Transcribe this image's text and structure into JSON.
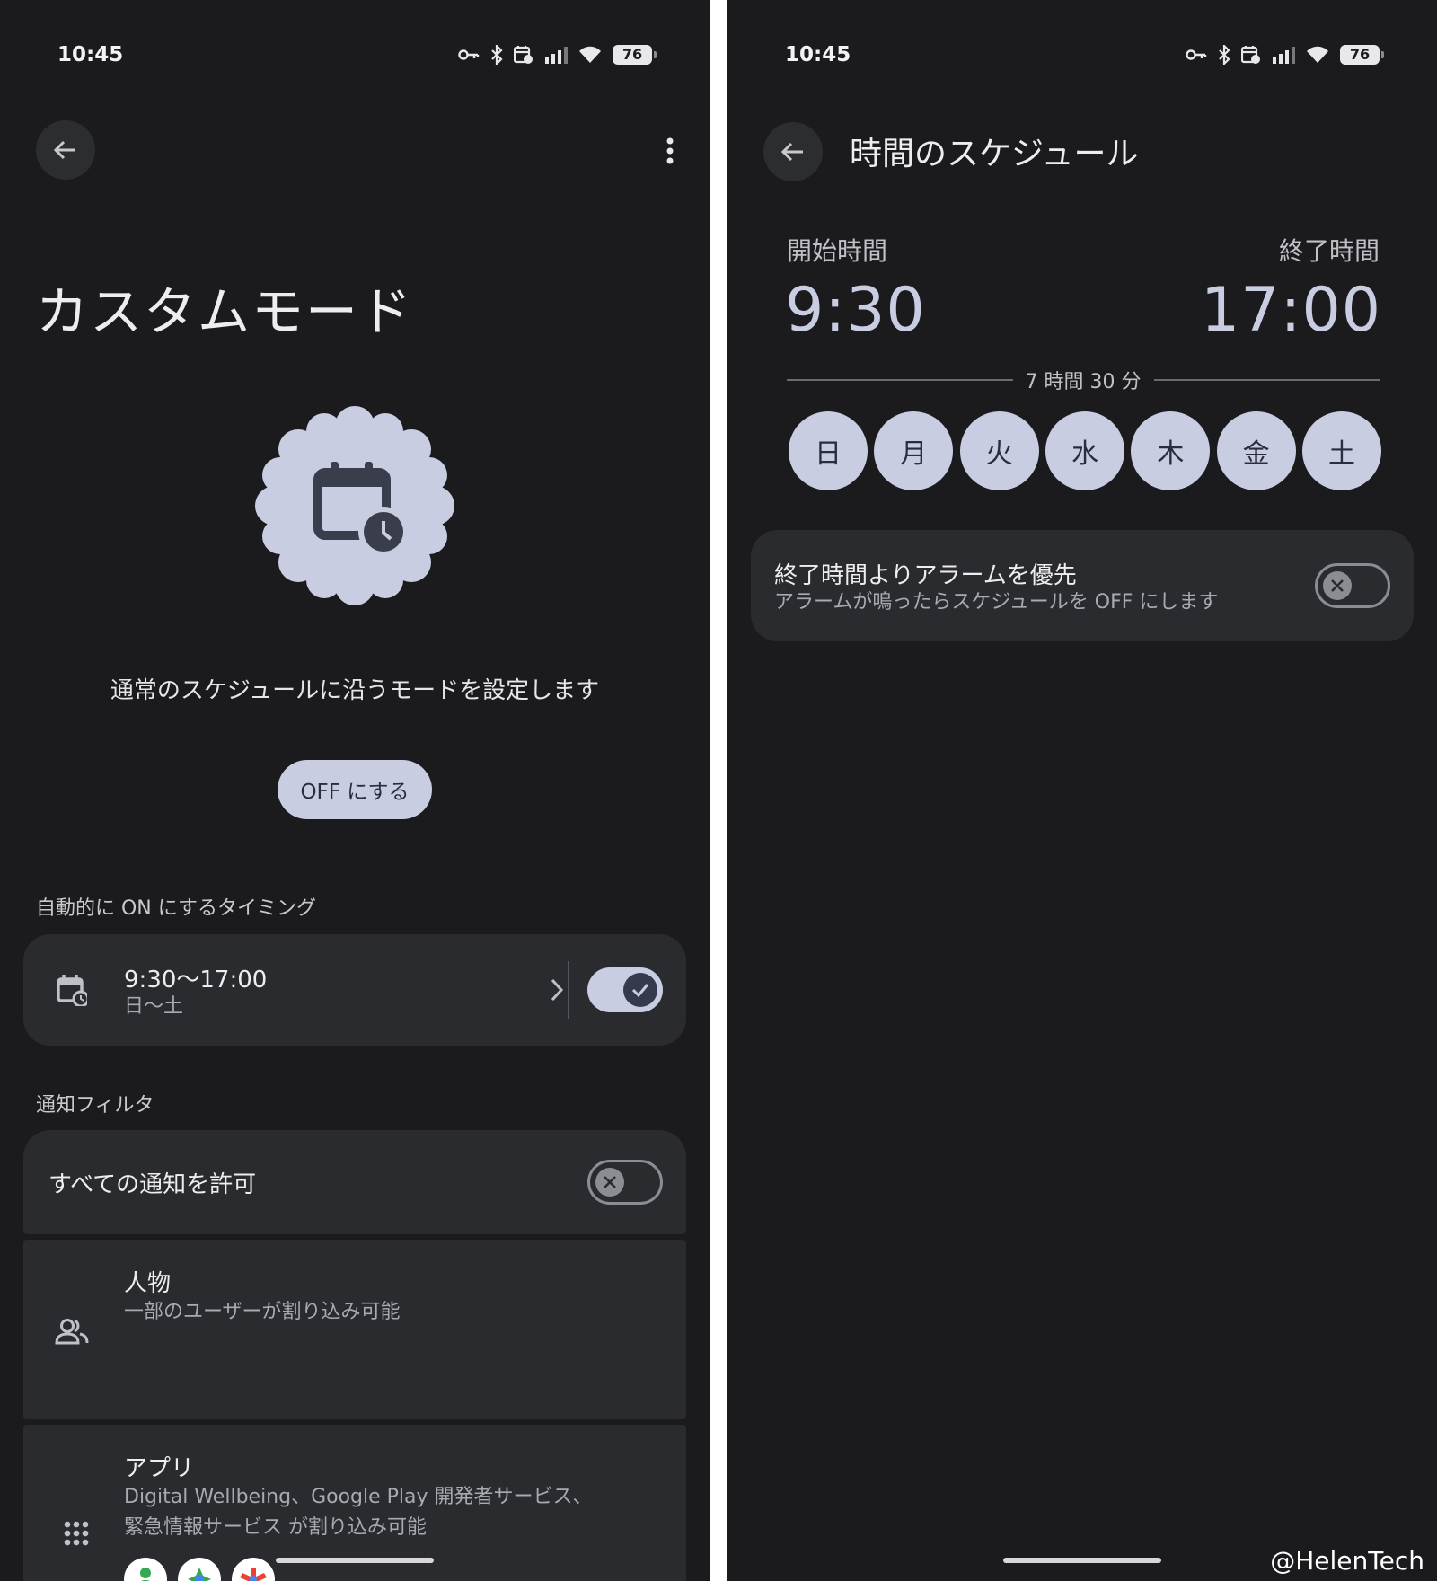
{
  "left": {
    "status": {
      "time": "10:45",
      "battery": "76"
    },
    "mode_title": "カスタムモード",
    "description": "通常のスケジュールに沿うモードを設定します",
    "off_button": "OFF にする",
    "auto_section_header": "自動的に ON にするタイミング",
    "schedule": {
      "time_range": "9:30〜17:00",
      "days": "日〜土",
      "enabled": true
    },
    "filter_section_header": "通知フィルタ",
    "allow_all": {
      "label": "すべての通知を許可",
      "enabled": false
    },
    "people": {
      "title": "人物",
      "subtitle": "一部のユーザーが割り込み可能"
    },
    "apps": {
      "title": "アプリ",
      "subtitle_line1": "Digital Wellbeing、Google Play 開発者サービス、",
      "subtitle_line2": "緊急情報サービス が割り込み可能"
    }
  },
  "right": {
    "status": {
      "time": "10:45",
      "battery": "76"
    },
    "title": "時間のスケジュール",
    "start_label": "開始時間",
    "start_time": "9:30",
    "end_label": "終了時間",
    "end_time": "17:00",
    "duration": "7 時間 30 分",
    "days": [
      "日",
      "月",
      "火",
      "水",
      "木",
      "金",
      "土"
    ],
    "alarm": {
      "title": "終了時間よりアラームを優先",
      "subtitle": "アラームが鳴ったらスケジュールを OFF にします",
      "enabled": false
    }
  },
  "watermark": "@HelenTech",
  "colors": {
    "background": "#1b1b1e",
    "card": "#2a2b2f",
    "accent": "#c9cde2",
    "accent_on": "#363a4d"
  },
  "icons": [
    "key-icon",
    "bluetooth-icon",
    "calendar-clock-icon",
    "signal-icon",
    "wifi-icon",
    "battery-icon",
    "back-arrow-icon",
    "more-vert-icon",
    "chevron-right-icon",
    "check-icon",
    "close-icon",
    "people-icon",
    "apps-grid-icon"
  ]
}
